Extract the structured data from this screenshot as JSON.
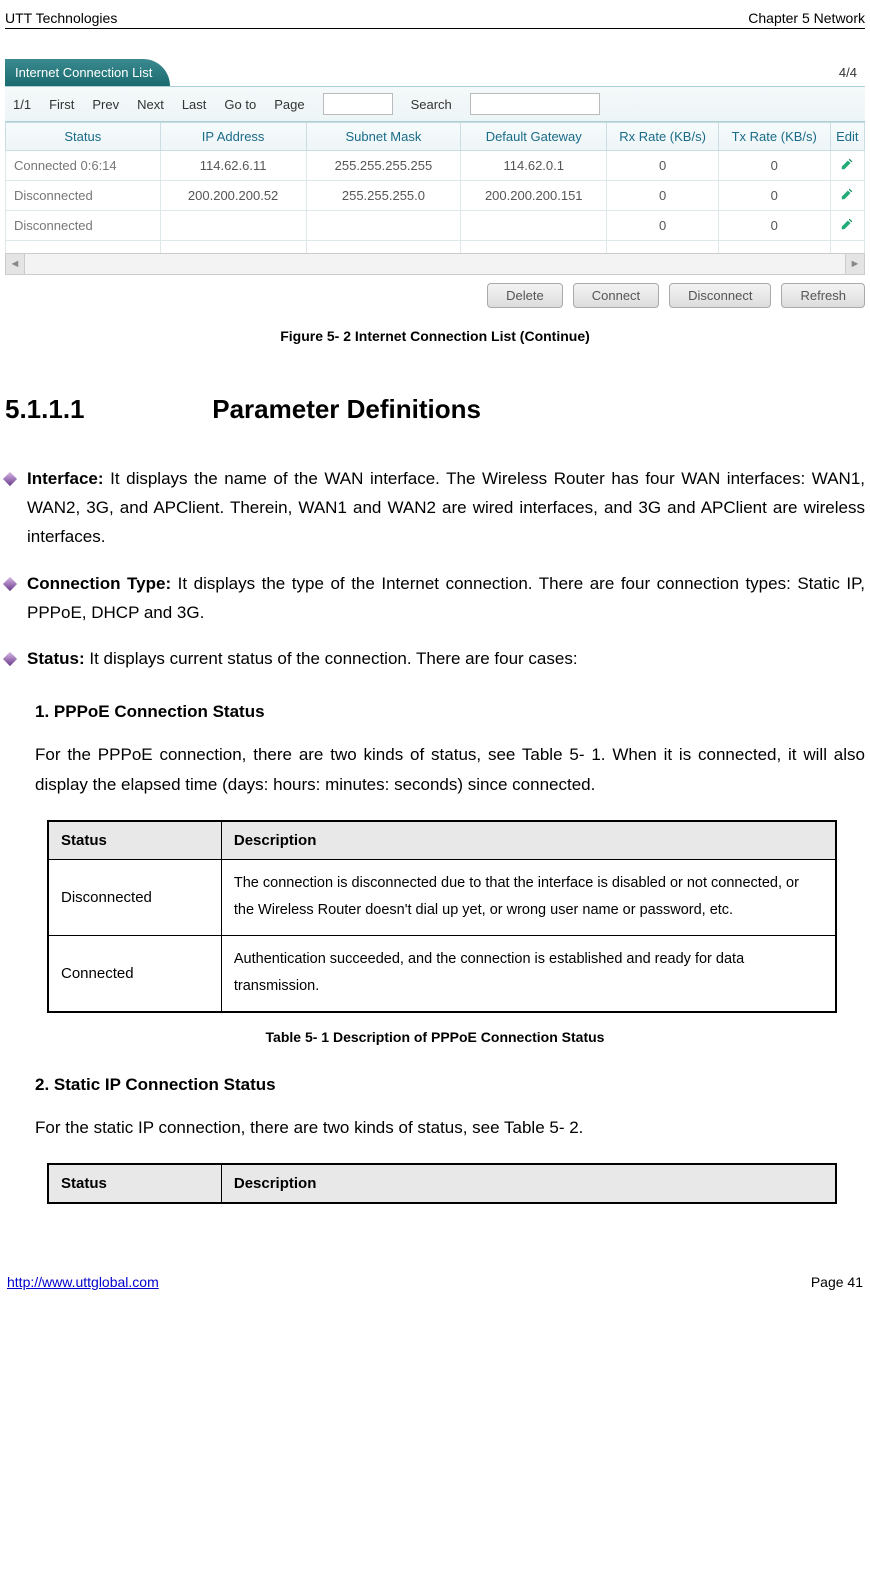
{
  "header": {
    "left": "UTT Technologies",
    "right": "Chapter 5 Network"
  },
  "panel": {
    "tab": "Internet Connection List",
    "pageCount": "4/4",
    "toolbar": {
      "counter": "1/1",
      "first": "First",
      "prev": "Prev",
      "next": "Next",
      "last": "Last",
      "goto": "Go to",
      "page": "Page",
      "search": "Search"
    },
    "columns": {
      "c1": "Status",
      "c2": "IP Address",
      "c3": "Subnet Mask",
      "c4": "Default Gateway",
      "c5": "Rx Rate (KB/s)",
      "c6": "Tx Rate (KB/s)",
      "c7": "Edit"
    },
    "rows": [
      {
        "status": "Connected 0:6:14",
        "ip": "114.62.6.11",
        "mask": "255.255.255.255",
        "gw": "114.62.0.1",
        "rx": "0",
        "tx": "0"
      },
      {
        "status": "Disconnected",
        "ip": "200.200.200.52",
        "mask": "255.255.255.0",
        "gw": "200.200.200.151",
        "rx": "0",
        "tx": "0"
      },
      {
        "status": "Disconnected",
        "ip": "",
        "mask": "",
        "gw": "",
        "rx": "0",
        "tx": "0"
      },
      {
        "status": "",
        "ip": "",
        "mask": "",
        "gw": "",
        "rx": "",
        "tx": ""
      }
    ],
    "buttons": {
      "del": "Delete",
      "conn": "Connect",
      "disc": "Disconnect",
      "refr": "Refresh"
    }
  },
  "figCaption": "Figure 5- 2 Internet Connection List (Continue)",
  "sectionNum": "5.1.1.1",
  "sectionTitle": "Parameter Definitions",
  "bullets": {
    "b1_label": "Interface:",
    "b1": " It displays the name of the WAN interface. The Wireless Router has four WAN interfaces: WAN1, WAN2, 3G, and APClient. Therein, WAN1 and WAN2 are wired interfaces, and 3G and APClient are wireless interfaces.",
    "b2_label": "Connection Type:",
    "b2": " It displays the type of the Internet connection. There are four connection types: Static IP, PPPoE, DHCP and 3G.",
    "b3_label": "Status:",
    "b3": " It displays current status of the connection. There are four cases:"
  },
  "subs": {
    "h1": "1.    PPPoE Connection Status",
    "p1": "For the PPPoE connection, there are two kinds of status, see Table 5- 1. When it is connected, it will also display the elapsed time (days: hours: minutes: seconds) since connected.",
    "h2": "2.    Static IP Connection Status",
    "p2": "For the static IP connection, there are two kinds of status, see Table 5- 2."
  },
  "table1": {
    "h1": "Status",
    "h2": "Description",
    "r1s": "Disconnected",
    "r1d": "The connection is disconnected due to that the interface is disabled or not connected, or the Wireless Router doesn't dial up yet, or wrong user name or password, etc.",
    "r2s": "Connected",
    "r2d": "Authentication succeeded, and the connection is established and ready for data transmission."
  },
  "table1Caption": "Table 5- 1 Description of PPPoE Connection Status",
  "table2": {
    "h1": "Status",
    "h2": "Description"
  },
  "footer": {
    "url": "http://www.uttglobal.com",
    "page": "Page 41"
  }
}
